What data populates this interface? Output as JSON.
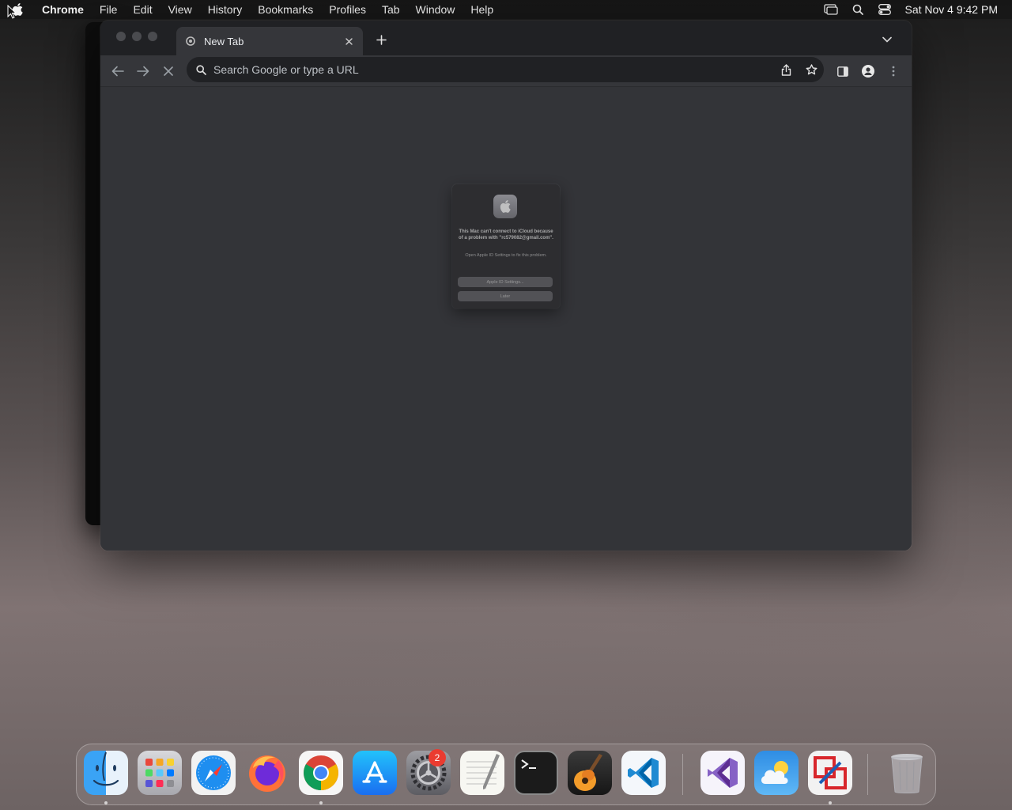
{
  "menubar": {
    "app_name": "Chrome",
    "items": [
      "File",
      "Edit",
      "View",
      "History",
      "Bookmarks",
      "Profiles",
      "Tab",
      "Window",
      "Help"
    ],
    "clock": "Sat Nov 4  9:42 PM"
  },
  "browser": {
    "tab_title": "New Tab",
    "omnibox_placeholder": "Search Google or type a URL"
  },
  "alert": {
    "message": "This Mac can't connect to iCloud because of a problem with \"rc579082@gmail.com\".",
    "detail": "Open Apple ID Settings to fix this problem.",
    "primary_button": "Apple ID Settings...",
    "secondary_button": "Later"
  },
  "dock": {
    "apps": [
      "Finder",
      "Launchpad",
      "Safari",
      "Firefox",
      "Google Chrome",
      "App Store",
      "System Settings",
      "TextEdit",
      "Terminal",
      "GarageBand",
      "Visual Studio Code",
      "Visual Studio",
      "Weather",
      "Parallels"
    ],
    "system_settings_badge": "2",
    "trash": "Trash"
  },
  "colors": {
    "window_bg": "#333438",
    "tabstrip_bg": "#202124",
    "badge_red": "#ea3b30"
  }
}
